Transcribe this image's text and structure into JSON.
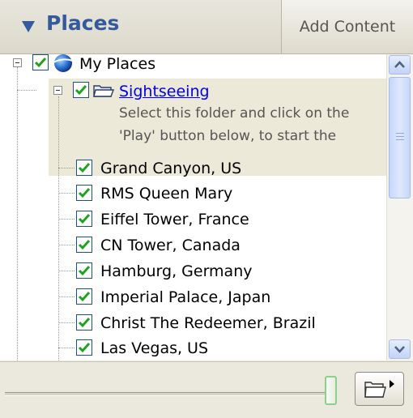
{
  "header": {
    "title": "Places",
    "add_content": "Add Content",
    "collapse_icon": "triangle-down-icon"
  },
  "tree": {
    "root": {
      "label": "My Places",
      "checked": true,
      "icon": "earth-globe-icon"
    },
    "folder": {
      "label": "Sightseeing",
      "checked": true,
      "icon": "open-folder-icon",
      "description_line1": "Select this folder and click on the",
      "description_line2": "'Play' button below, to start the"
    },
    "items": [
      {
        "label": "Grand Canyon, US",
        "checked": true
      },
      {
        "label": "RMS Queen Mary",
        "checked": true
      },
      {
        "label": "Eiffel Tower, France",
        "checked": true
      },
      {
        "label": "CN Tower, Canada",
        "checked": true
      },
      {
        "label": "Hamburg, Germany",
        "checked": true
      },
      {
        "label": "Imperial Palace, Japan",
        "checked": true
      },
      {
        "label": "Christ The Redeemer, Brazil",
        "checked": true
      },
      {
        "label": "Las Vegas, US",
        "checked": true
      }
    ]
  },
  "tour": {
    "speed_fraction": 1.0,
    "play_icon": "folder-play-icon"
  },
  "colors": {
    "accent": "#34599c",
    "link": "#0000ee",
    "check": "#21a121",
    "selection_bg": "#ece9d8"
  }
}
